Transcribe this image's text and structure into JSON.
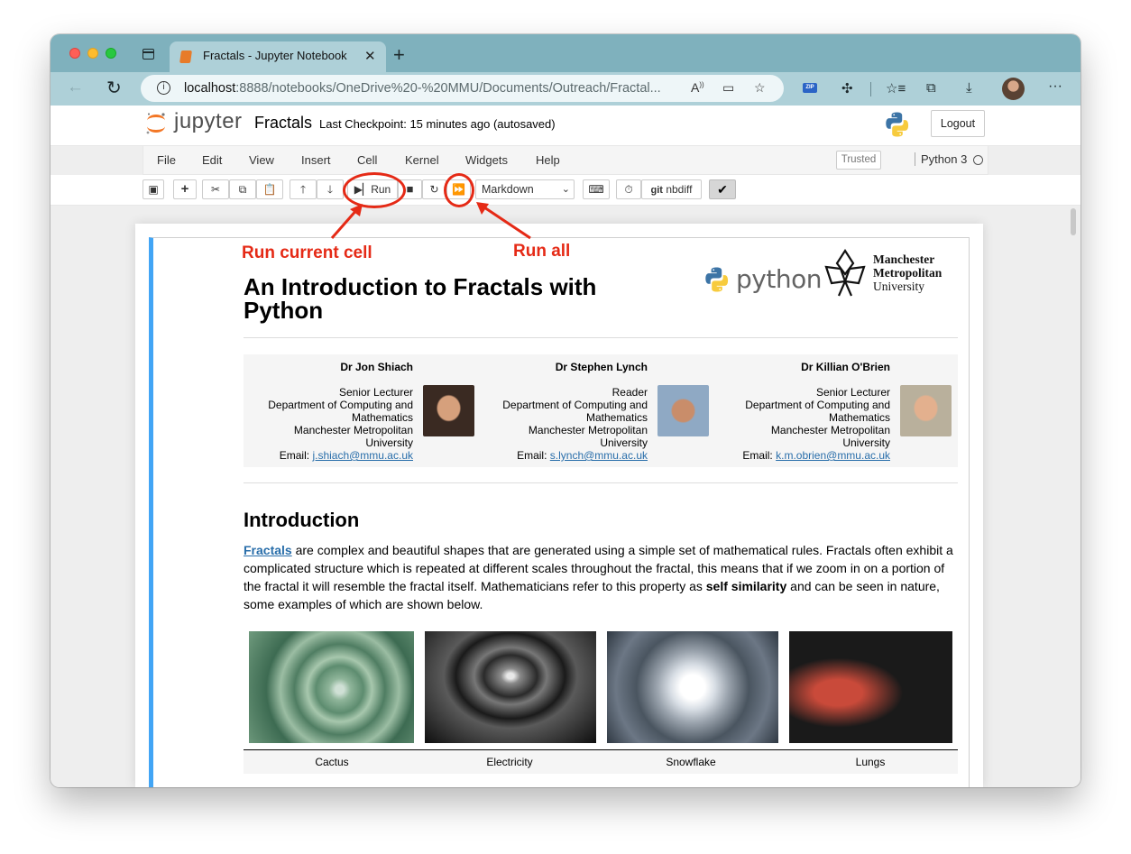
{
  "browser": {
    "tab_title": "Fractals - Jupyter Notebook",
    "url_host": "localhost",
    "url_rest": ":8888/notebooks/OneDrive%20-%20MMU/Documents/Outreach/Fractal..."
  },
  "jupyter": {
    "logo_text": "jupyter",
    "notebook_name": "Fractals",
    "checkpoint": "Last Checkpoint: 15 minutes ago  (autosaved)",
    "logout_label": "Logout",
    "menu": [
      "File",
      "Edit",
      "View",
      "Insert",
      "Cell",
      "Kernel",
      "Widgets",
      "Help"
    ],
    "trusted_label": "Trusted",
    "kernel_name": "Python 3",
    "run_label": "Run",
    "cell_type": "Markdown",
    "nbdiff_label": "nbdiff",
    "git_label": "git"
  },
  "annotations": {
    "run_current_cell": "Run current cell",
    "run_all": "Run all",
    "color": "#e52a16"
  },
  "notebook": {
    "title": "An Introduction to Fractals with Python",
    "python_logo_text": "python",
    "mmu_logo_lines": [
      "Manchester",
      "Metropolitan",
      "University"
    ],
    "authors": [
      {
        "name": "Dr Jon Shiach",
        "lines": [
          "Senior Lecturer",
          "Department of Computing and",
          "Mathematics",
          "Manchester Metropolitan",
          "University"
        ],
        "email_prefix": "Email: ",
        "email": "j.shiach@mmu.ac.uk"
      },
      {
        "name": "Dr Stephen Lynch",
        "lines": [
          "Reader",
          "Department of Computing and",
          "Mathematics",
          "Manchester Metropolitan",
          "University"
        ],
        "email_prefix": "Email: ",
        "email": "s.lynch@mmu.ac.uk"
      },
      {
        "name": "Dr Killian O'Brien",
        "lines": [
          "Senior Lecturer",
          "Department of Computing and",
          "Mathematics",
          "Manchester Metropolitan",
          "University"
        ],
        "email_prefix": "Email: ",
        "email": "k.m.obrien@mmu.ac.uk"
      }
    ],
    "section_heading": "Introduction",
    "paragraph": {
      "link": "Fractals",
      "text1": " are complex and beautiful shapes that are generated using a simple set of mathematical rules. Fractals often exhibit a complicated structure which is repeated at different scales throughout the fractal, this means that if we zoom in on a portion of the fractal it will resemble the fractal itself. Mathematicians refer to this property as ",
      "bold": "self similarity",
      "text2": " and can be seen in nature, some examples of which are shown below."
    },
    "captions": [
      "Cactus",
      "Electricity",
      "Snowflake",
      "Lungs"
    ]
  }
}
